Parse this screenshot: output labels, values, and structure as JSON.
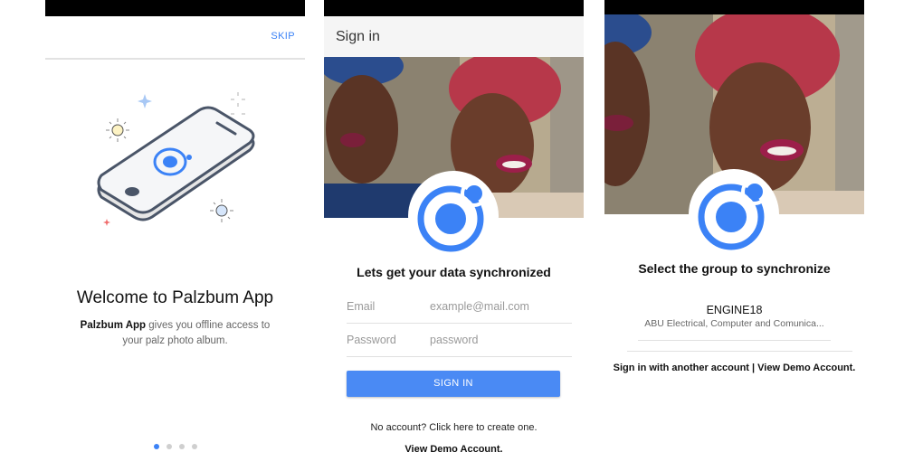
{
  "colors": {
    "accent": "#3b82f6",
    "button": "#4a8af4",
    "status_bar": "#000000",
    "header_bg": "#f5f5f5"
  },
  "onboarding": {
    "skip_label": "SKIP",
    "title": "Welcome to Palzbum App",
    "description_bold": "Palzbum App",
    "description_rest": " gives you offline access to your palz photo album.",
    "pagination": {
      "total": 4,
      "active_index": 0
    },
    "illustration_icon": "phone-with-ionic-logo-icon"
  },
  "signin": {
    "header_title": "Sign in",
    "heading": "Lets get your data synchronized",
    "email": {
      "label": "Email",
      "placeholder": "example@mail.com",
      "value": ""
    },
    "password": {
      "label": "Password",
      "placeholder": "password",
      "value": ""
    },
    "submit_label": "SIGN IN",
    "no_account_text": "No account? Click here to create one.",
    "demo_link": "View Demo Account.",
    "logo_icon": "ionic-logo-icon"
  },
  "select_group": {
    "heading": "Select the group to synchronize",
    "groups": [
      {
        "name": "ENGINE18",
        "description": "ABU Electrical, Computer and Comunica..."
      }
    ],
    "another_account_link": "Sign in with another account",
    "separator": " | ",
    "demo_link": "View Demo Account.",
    "logo_icon": "ionic-logo-icon"
  }
}
